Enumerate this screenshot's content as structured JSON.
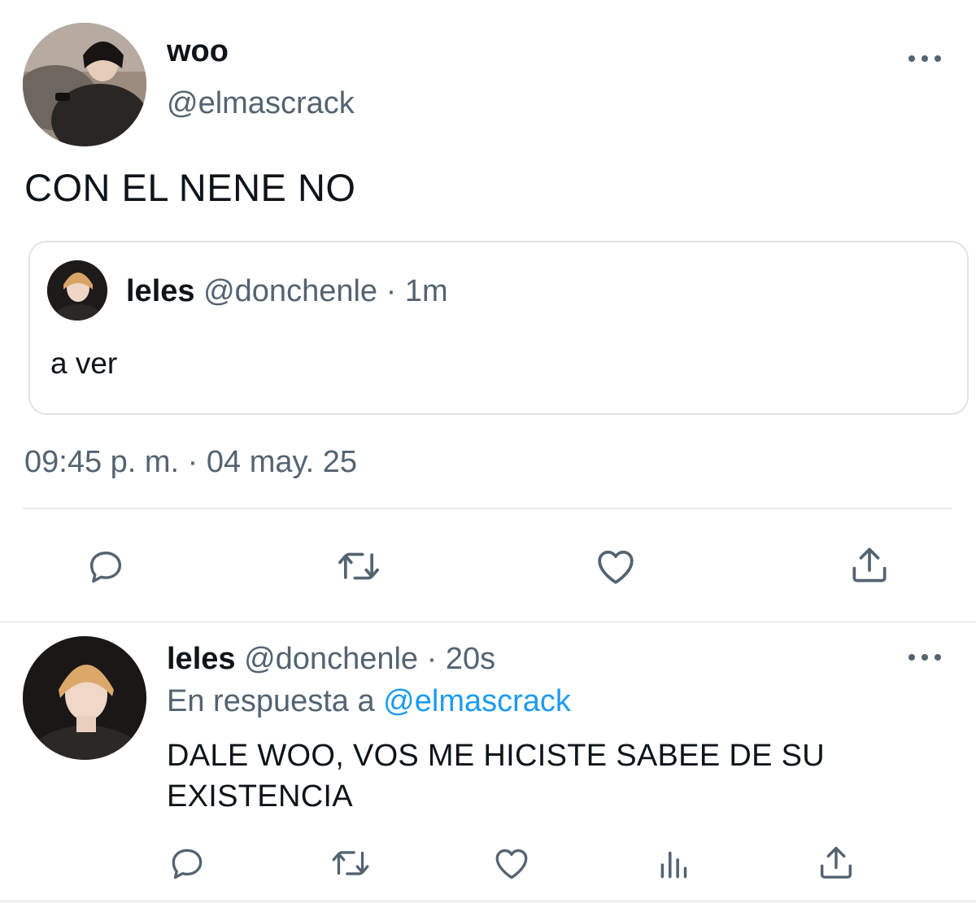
{
  "main_tweet": {
    "author_name": "woo",
    "author_handle": "@elmascrack",
    "text": "CON EL NENE NO",
    "timestamp": "09:45 p. m. · 04 may. 25",
    "more_icon": "more-horizontal-icon",
    "quoted_tweet": {
      "author_name": "leles",
      "meta": "@donchenle · 1m",
      "text": "a ver"
    },
    "actions": [
      "reply-icon",
      "retweet-icon",
      "like-icon",
      "share-icon"
    ]
  },
  "reply_tweet": {
    "author_name": "leles",
    "meta": "@donchenle · 20s",
    "reply_to_label": "En respuesta a",
    "reply_to_handle": "@elmascrack",
    "text": "DALE WOO, VOS ME HICISTE SABEE DE SU EXISTENCIA",
    "more_icon": "more-horizontal-icon",
    "actions": [
      "reply-icon",
      "retweet-icon",
      "like-icon",
      "views-icon",
      "share-icon"
    ]
  },
  "colors": {
    "text_primary": "#0f1419",
    "text_secondary": "#536471",
    "link": "#1d9bf0",
    "border": "#dfe3e7"
  }
}
